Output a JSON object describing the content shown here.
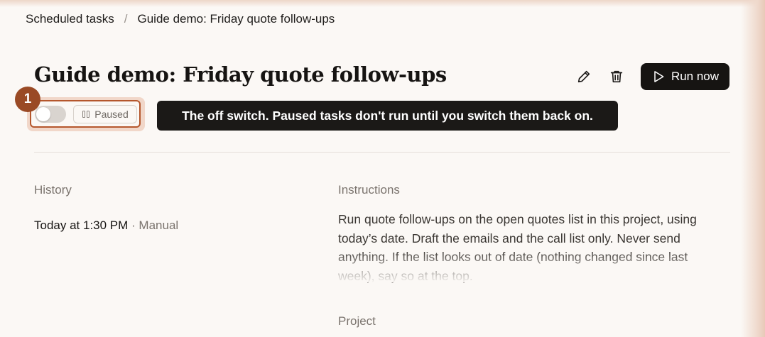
{
  "breadcrumb": {
    "parent": "Scheduled tasks",
    "separator": "/",
    "current": "Guide demo: Friday quote follow-ups"
  },
  "task": {
    "title": "Guide demo: Friday quote follow-ups",
    "status_label": "Paused",
    "enabled": false
  },
  "toolbar": {
    "edit_icon": "pencil-icon",
    "delete_icon": "trash-icon",
    "run_label": "Run now",
    "run_icon": "play-icon"
  },
  "guide": {
    "step_number": "1",
    "tooltip": "The off switch. Paused tasks don't run until you switch them back on."
  },
  "history": {
    "label": "History",
    "entries": [
      {
        "time": "Today at 1:30 PM",
        "separator": " · ",
        "trigger": "Manual"
      }
    ]
  },
  "instructions": {
    "label": "Instructions",
    "text": "Run quote follow-ups on the open quotes list in this project, using today’s date. Draft the emails and the call list only. Never send anything. If the list looks out of date (nothing changed since last week), say so at the top."
  },
  "project": {
    "label": "Project"
  },
  "colors": {
    "accent": "#b5572d",
    "badge": "#9a4a25",
    "button_dark": "#161412",
    "background": "#fbf8f5"
  }
}
